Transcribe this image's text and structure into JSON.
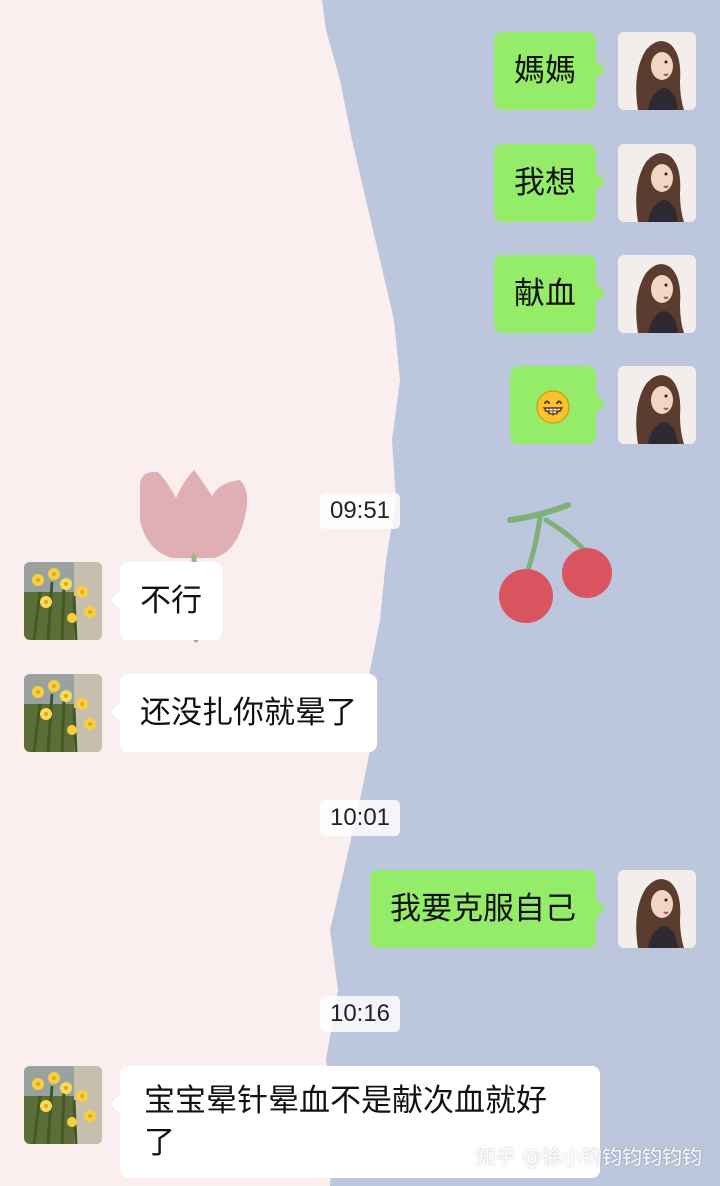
{
  "chat": {
    "messages": [
      {
        "side": "right",
        "text": "媽媽"
      },
      {
        "side": "right",
        "text": "我想"
      },
      {
        "side": "right",
        "text": "献血"
      },
      {
        "side": "right",
        "emoji": "grinning-face-icon"
      },
      {
        "time": "09:51"
      },
      {
        "side": "left",
        "text": "不行"
      },
      {
        "side": "left",
        "text": "还没扎你就晕了"
      },
      {
        "time": "10:01"
      },
      {
        "side": "right",
        "text": "我要克服自己"
      },
      {
        "time": "10:16"
      },
      {
        "side": "left",
        "text": "宝宝晕针晕血不是献次血就好了"
      }
    ]
  },
  "watermark": "知乎 @徐小钧钧钧钧钧钧",
  "colors": {
    "bubble_sent": "#95ec69",
    "bubble_received": "#ffffff",
    "bg_left": "#fbeeee",
    "bg_right": "#bcc6dc"
  }
}
